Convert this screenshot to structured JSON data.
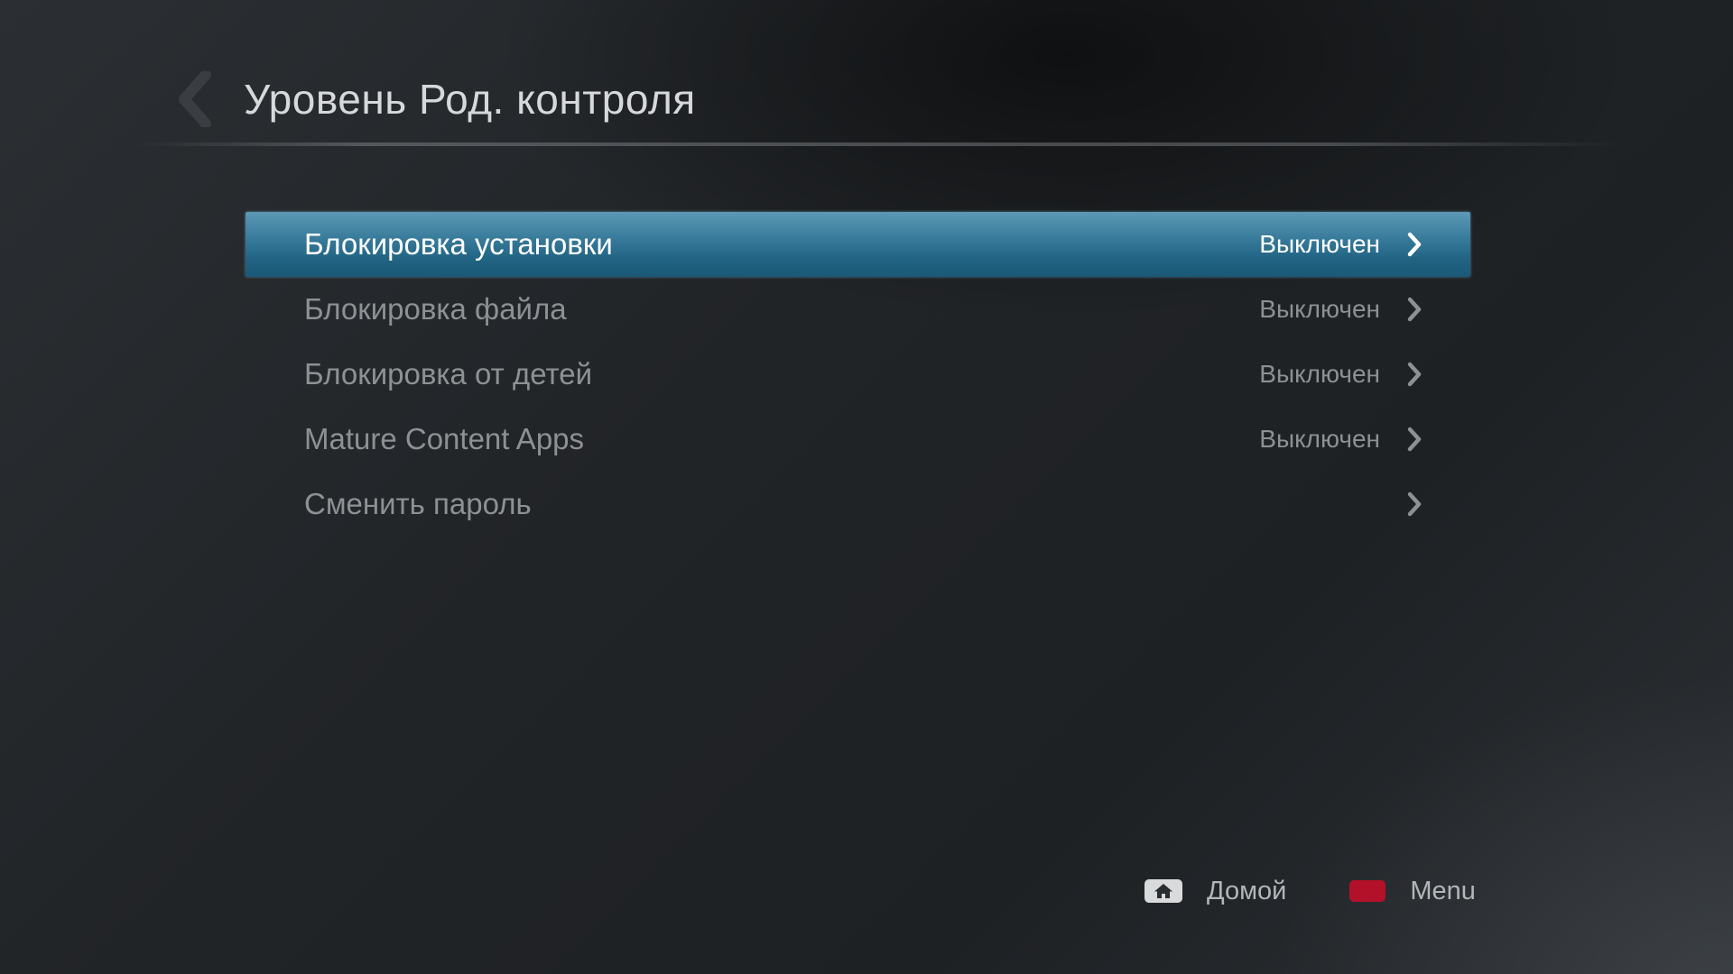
{
  "header": {
    "back_icon": "chevron-left-icon",
    "title": "Уровень Род. контроля"
  },
  "menu": {
    "selected_index": 0,
    "items": [
      {
        "label": "Блокировка установки",
        "value": "Выключен",
        "icon": "chevron-right-icon"
      },
      {
        "label": "Блокировка файла",
        "value": "Выключен",
        "icon": "chevron-right-icon"
      },
      {
        "label": "Блокировка от детей",
        "value": "Выключен",
        "icon": "chevron-right-icon"
      },
      {
        "label": "Mature Content Apps",
        "value": "Выключен",
        "icon": "chevron-right-icon"
      },
      {
        "label": "Сменить пароль",
        "value": "",
        "icon": "chevron-right-icon"
      }
    ]
  },
  "footer": {
    "home": {
      "icon": "home-icon",
      "label": "Домой"
    },
    "menu": {
      "icon": "red-button-icon",
      "label": "Menu"
    }
  },
  "colors": {
    "selection": "#236584",
    "red_key": "#b3102a"
  }
}
